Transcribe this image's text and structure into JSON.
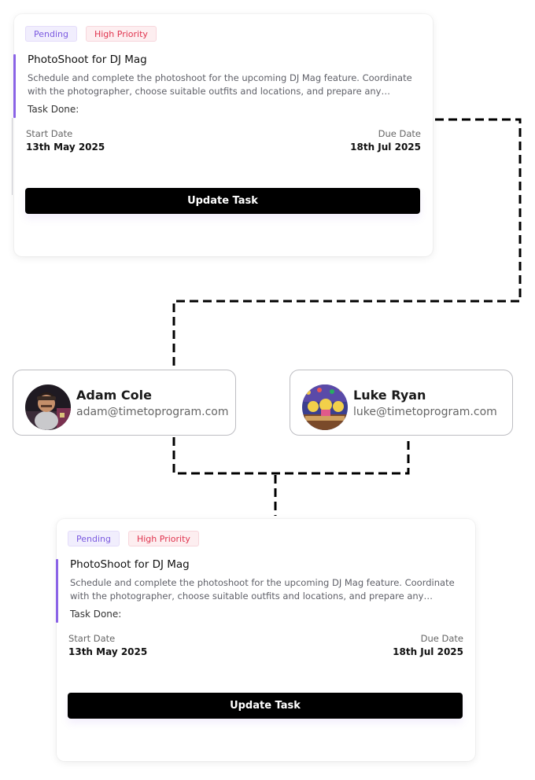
{
  "task_cards": [
    {
      "status": "Pending",
      "priority": "High Priority",
      "title": "PhotoShoot for DJ Mag",
      "description": "Schedule and complete the photoshoot for the upcoming DJ Mag feature. Coordinate with the photographer, choose suitable outfits and locations, and prepare any required…",
      "task_done_label": "Task Done:",
      "start_date_label": "Start Date",
      "start_date": "13th May 2025",
      "due_date_label": "Due Date",
      "due_date": "18th Jul 2025",
      "button_label": "Update Task"
    },
    {
      "status": "Pending",
      "priority": "High Priority",
      "title": "PhotoShoot for DJ Mag",
      "description": "Schedule and complete the photoshoot for the upcoming DJ Mag feature. Coordinate with the photographer, choose suitable outfits and locations, and prepare any required…",
      "task_done_label": "Task Done:",
      "start_date_label": "Start Date",
      "start_date": "13th May 2025",
      "due_date_label": "Due Date",
      "due_date": "18th Jul 2025",
      "button_label": "Update Task"
    }
  ],
  "users": [
    {
      "name": "Adam Cole",
      "email": "adam@timetoprogram.com",
      "avatar": "user-photo"
    },
    {
      "name": "Luke Ryan",
      "email": "luke@timetoprogram.com",
      "avatar": "cartoon-avatar"
    }
  ],
  "colors": {
    "accent": "#8a63e6",
    "pending_text": "#7b5ae0",
    "priority_text": "#e0344e",
    "button_bg": "#000000"
  }
}
